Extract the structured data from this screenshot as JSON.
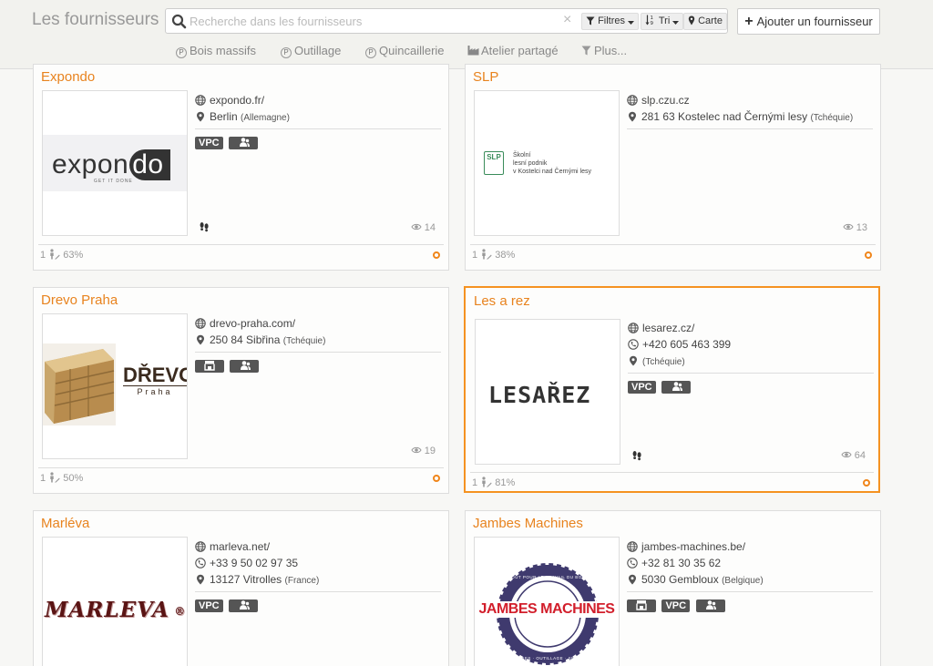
{
  "header": {
    "title": "Les fournisseurs",
    "search_placeholder": "Recherche dans les fournisseurs",
    "clear_icon": "×",
    "filters_label": "Filtres",
    "sort_label": "Tri",
    "map_label": "Carte",
    "add_label": "Ajouter un fournisseur"
  },
  "categories": [
    {
      "label": "Bois massifs",
      "icon": "p-circle-icon"
    },
    {
      "label": "Outillage",
      "icon": "p-circle-icon"
    },
    {
      "label": "Quincaillerie",
      "icon": "p-circle-icon"
    },
    {
      "label": "Atelier partagé",
      "icon": "factory-icon"
    },
    {
      "label": "Plus...",
      "icon": "funnel-icon"
    }
  ],
  "colors": {
    "accent": "#e8831e",
    "badge": "#555555",
    "active_border": "#f59221"
  },
  "cards": [
    {
      "name": "Expondo",
      "website": "expondo.fr/",
      "location": "Berlin",
      "country": "(Allemagne)",
      "badge_vpc": "VPC",
      "views": "14",
      "count": "1",
      "percent": "63%",
      "logo_main": "expon",
      "logo_accent": "do",
      "logo_tagline": "GET IT DONE"
    },
    {
      "name": "SLP",
      "website": "slp.czu.cz",
      "location": "281 63 Kostelec nad Černými lesy",
      "country": "(Tchéquie)",
      "views": "13",
      "count": "1",
      "percent": "38%",
      "logo_mark": "SLP",
      "logo_line1": "Školní",
      "logo_line2": "lesní podnik",
      "logo_line3": "v Kostelci nad Černými lesy"
    },
    {
      "name": "Drevo Praha",
      "website": "drevo-praha.com/",
      "location": "250 84 Sibřina",
      "country": "(Tchéquie)",
      "views": "19",
      "count": "1",
      "percent": "50%",
      "logo_main": "DŘEVO",
      "logo_sub": "Praha"
    },
    {
      "name": "Les a rez",
      "website": "lesarez.cz/",
      "phone": "+420 605 463 399",
      "country": "(Tchéquie)",
      "badge_vpc": "VPC",
      "views": "64",
      "count": "1",
      "percent": "81%",
      "logo_text": "LESAŘEZ"
    },
    {
      "name": "Marléva",
      "website": "marleva.net/",
      "phone": "+33 9 50 02 97 35",
      "location": "13127 Vitrolles",
      "country": "(France)",
      "badge_vpc": "VPC",
      "logo_text": "MARLEVA"
    },
    {
      "name": "Jambes Machines",
      "website": "jambes-machines.be/",
      "phone": "+32 81 30 35 62",
      "location": "5030 Gembloux",
      "country": "(Belgique)",
      "badge_vpc": "VPC",
      "logo_text": "JAMBES MACHINES",
      "logo_arc_top": "TOUT POUR LE TRAVAIL DU BOIS",
      "logo_arc_bottom": "MACHINES · OUTILLAGE · SERVICE"
    }
  ]
}
